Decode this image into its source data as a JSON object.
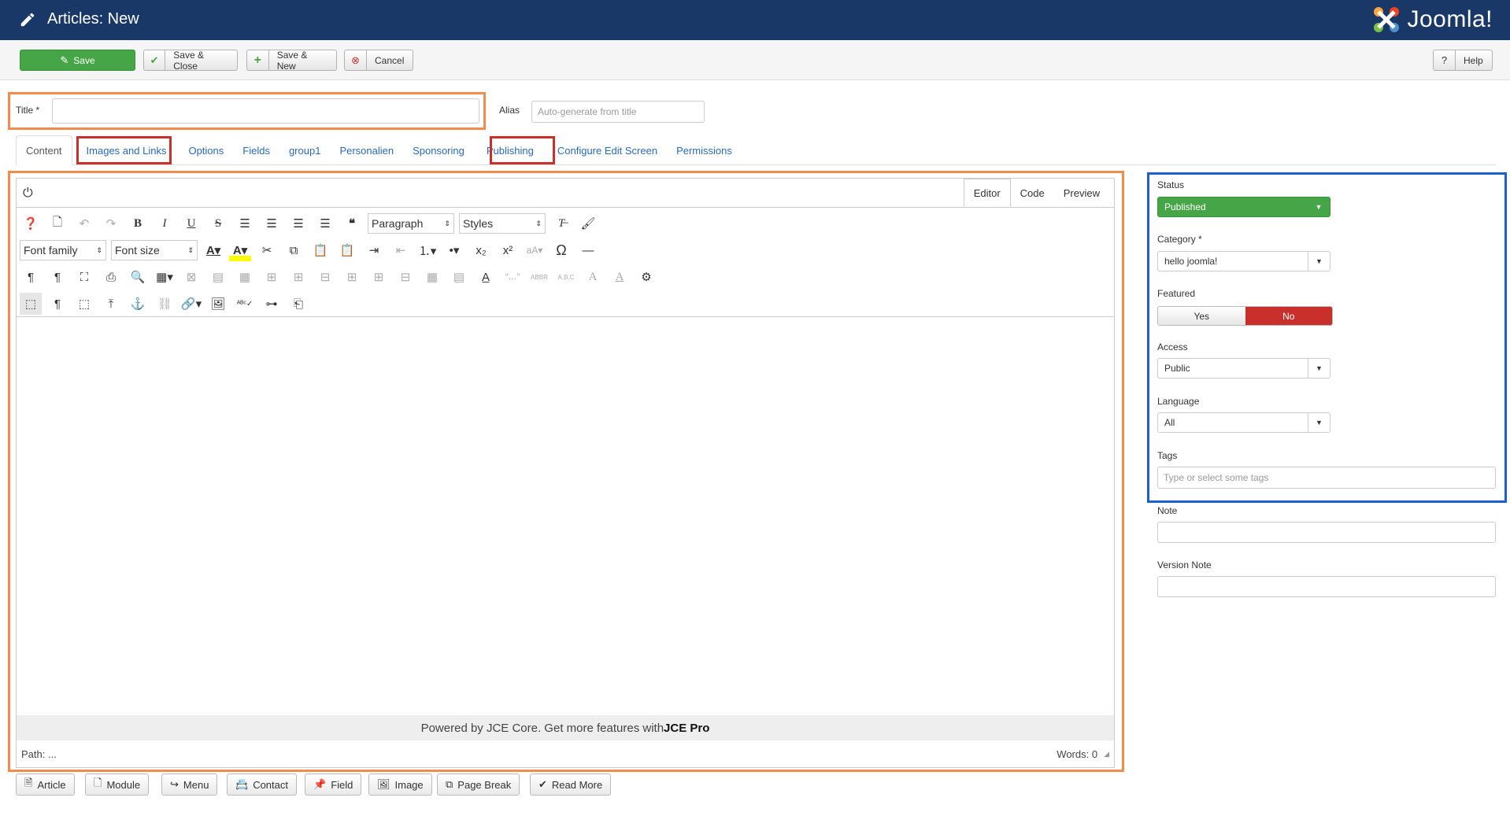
{
  "header": {
    "title": "Articles: New",
    "brand": "Joomla!"
  },
  "toolbar": {
    "save": "Save",
    "save_close": "Save & Close",
    "save_new": "Save & New",
    "cancel": "Cancel",
    "help": "Help"
  },
  "form": {
    "title_label": "Title *",
    "title_value": "",
    "alias_label": "Alias",
    "alias_placeholder": "Auto-generate from title"
  },
  "tabs": [
    "Content",
    "Images and Links",
    "Options",
    "Fields",
    "group1",
    "Personalien",
    "Sponsoring",
    "Publishing",
    "Configure Edit Screen",
    "Permissions"
  ],
  "editor": {
    "modes": [
      "Editor",
      "Code",
      "Preview"
    ],
    "format_select": "Paragraph",
    "styles_select": "Styles",
    "font_family": "Font family",
    "font_size": "Font size",
    "powered_text": "Powered by JCE Core. Get more features with ",
    "powered_bold": "JCE Pro",
    "path": "Path: ...",
    "words": "Words: 0"
  },
  "sidebar": {
    "status_label": "Status",
    "status_value": "Published",
    "category_label": "Category *",
    "category_value": "hello joomla!",
    "featured_label": "Featured",
    "featured_yes": "Yes",
    "featured_no": "No",
    "access_label": "Access",
    "access_value": "Public",
    "language_label": "Language",
    "language_value": "All",
    "tags_label": "Tags",
    "tags_placeholder": "Type or select some tags",
    "note_label": "Note",
    "version_note_label": "Version Note"
  },
  "bottom_buttons": [
    "Article",
    "Module",
    "Menu",
    "Contact",
    "Field",
    "Image",
    "Page Break",
    "Read More"
  ],
  "colors": {
    "header_bg": "#1a3867",
    "save_green": "#46a546",
    "no_red": "#c9302c",
    "status_green": "#46a546",
    "highlight_orange": "#f08c4c",
    "highlight_blue": "#1c5fd3"
  }
}
